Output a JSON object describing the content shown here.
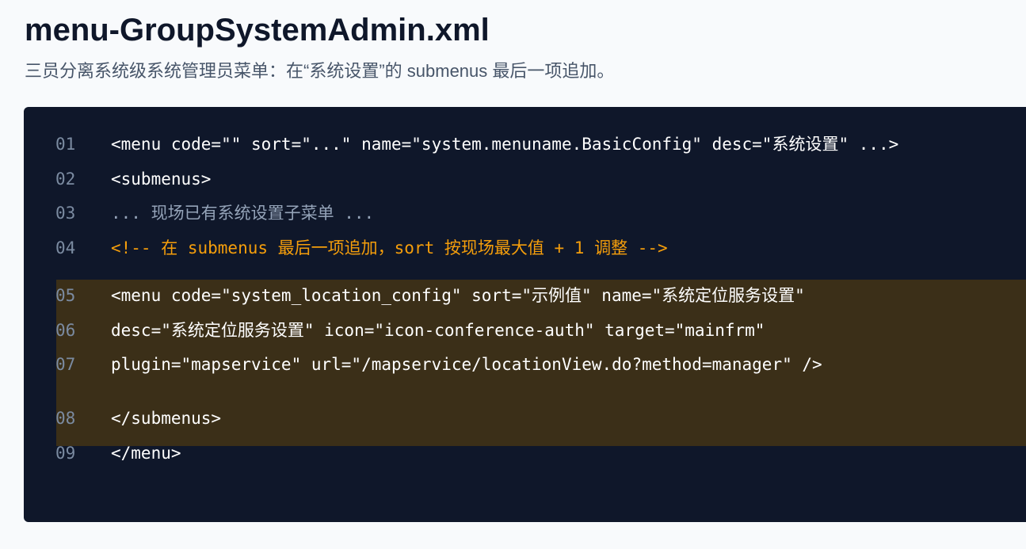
{
  "document": {
    "title": "menu-GroupSystemAdmin.xml",
    "subtitle": "三员分离系统级系统管理员菜单：在“系统设置”的 submenus 最后一项追加。"
  },
  "code_block": {
    "highlight_color": "#3b2f18",
    "lines": [
      {
        "number": "01",
        "text": "<menu code=\"\" sort=\"...\" name=\"system.menuname.BasicConfig\" desc=\"系统设置\" ...>"
      },
      {
        "number": "02",
        "text": "<submenus>"
      },
      {
        "number": "03",
        "text": "... 现场已有系统设置子菜单 ..."
      },
      {
        "number": "04",
        "text": "<!-- 在 submenus 最后一项追加，sort 按现场最大值 + 1 调整 -->"
      },
      {
        "number": "05",
        "text": "<menu code=\"system_location_config\" sort=\"示例值\" name=\"系统定位服务设置\""
      },
      {
        "number": "06",
        "text": "desc=\"系统定位服务设置\" icon=\"icon-conference-auth\" target=\"mainfrm\""
      },
      {
        "number": "07",
        "text": "plugin=\"mapservice\" url=\"/mapservice/locationView.do?method=manager\" />"
      },
      {
        "number": "08",
        "text": "</submenus>"
      },
      {
        "number": "09",
        "text": "</menu>"
      }
    ]
  },
  "colors": {
    "page_background": "#f8fafc",
    "code_background": "#0f172a",
    "line_number": "#7b8ba1",
    "code_text": "#ffffff",
    "muted_text": "#94a3b8",
    "comment_text": "#f59e0b"
  }
}
